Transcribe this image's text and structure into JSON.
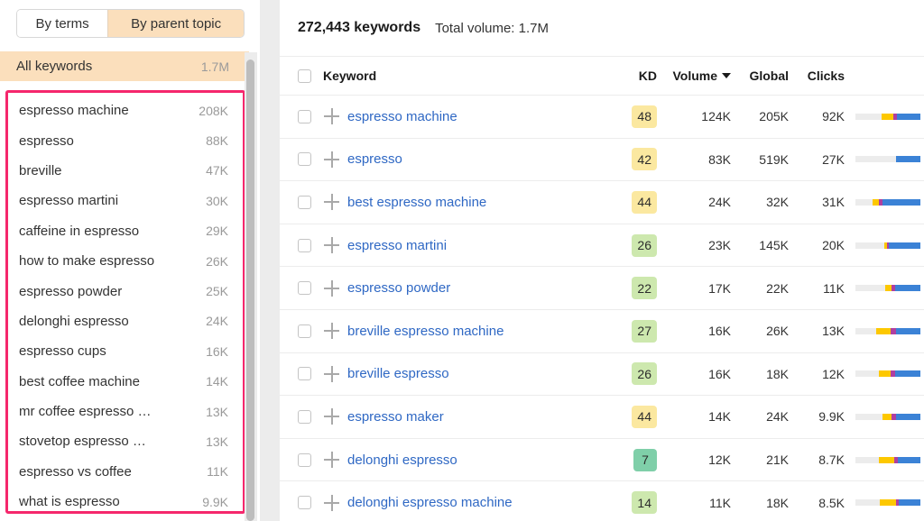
{
  "sidebar": {
    "tabs": [
      {
        "label": "By terms",
        "active": false
      },
      {
        "label": "By parent topic",
        "active": true
      }
    ],
    "all_keywords": {
      "label": "All keywords",
      "volume": "1.7M"
    },
    "highlight_color": "#f5276c",
    "items": [
      {
        "label": "espresso machine",
        "volume": "208K"
      },
      {
        "label": "espresso",
        "volume": "88K"
      },
      {
        "label": "breville",
        "volume": "47K"
      },
      {
        "label": "espresso martini",
        "volume": "30K"
      },
      {
        "label": "caffeine in espresso",
        "volume": "29K"
      },
      {
        "label": "how to make espresso",
        "volume": "26K"
      },
      {
        "label": "espresso powder",
        "volume": "25K"
      },
      {
        "label": "delonghi espresso",
        "volume": "24K"
      },
      {
        "label": "espresso cups",
        "volume": "16K"
      },
      {
        "label": "best coffee machine",
        "volume": "14K"
      },
      {
        "label": "mr coffee espresso …",
        "volume": "13K"
      },
      {
        "label": "stovetop espresso …",
        "volume": "13K"
      },
      {
        "label": "espresso vs coffee",
        "volume": "11K"
      },
      {
        "label": "what is espresso",
        "volume": "9.9K"
      }
    ]
  },
  "main": {
    "keyword_count": "272,443 keywords",
    "total_volume": "Total volume: 1.7M",
    "columns": {
      "keyword": "Keyword",
      "kd": "KD",
      "volume": "Volume",
      "global": "Global",
      "clicks": "Clicks"
    },
    "sorted_by": "Volume",
    "rows": [
      {
        "keyword": "espresso machine",
        "kd": "48",
        "kd_color": "#fbe8a0",
        "volume": "124K",
        "global": "205K",
        "clicks": "92K",
        "serp": [
          {
            "color": "#ececec",
            "pct": 40
          },
          {
            "color": "#fdc800",
            "pct": 18
          },
          {
            "color": "#b03fa0",
            "pct": 6
          },
          {
            "color": "#3b82d6",
            "pct": 36
          }
        ]
      },
      {
        "keyword": "espresso",
        "kd": "42",
        "kd_color": "#fbe8a0",
        "volume": "83K",
        "global": "519K",
        "clicks": "27K",
        "serp": [
          {
            "color": "#ececec",
            "pct": 63
          },
          {
            "color": "#fdc800",
            "pct": 0
          },
          {
            "color": "#b03fa0",
            "pct": 0
          },
          {
            "color": "#3b82d6",
            "pct": 37
          }
        ]
      },
      {
        "keyword": "best espresso machine",
        "kd": "44",
        "kd_color": "#fbe8a0",
        "volume": "24K",
        "global": "32K",
        "clicks": "31K",
        "serp": [
          {
            "color": "#ececec",
            "pct": 26
          },
          {
            "color": "#fdc800",
            "pct": 10
          },
          {
            "color": "#b03fa0",
            "pct": 6
          },
          {
            "color": "#3b82d6",
            "pct": 58
          }
        ]
      },
      {
        "keyword": "espresso martini",
        "kd": "26",
        "kd_color": "#cde8ae",
        "volume": "23K",
        "global": "145K",
        "clicks": "20K",
        "serp": [
          {
            "color": "#ececec",
            "pct": 44
          },
          {
            "color": "#fdc800",
            "pct": 4
          },
          {
            "color": "#b03fa0",
            "pct": 4
          },
          {
            "color": "#3b82d6",
            "pct": 48
          }
        ]
      },
      {
        "keyword": "espresso powder",
        "kd": "22",
        "kd_color": "#cde8ae",
        "volume": "17K",
        "global": "22K",
        "clicks": "11K",
        "serp": [
          {
            "color": "#ececec",
            "pct": 46
          },
          {
            "color": "#fdc800",
            "pct": 9
          },
          {
            "color": "#b03fa0",
            "pct": 6
          },
          {
            "color": "#3b82d6",
            "pct": 39
          }
        ]
      },
      {
        "keyword": "breville espresso machine",
        "kd": "27",
        "kd_color": "#cde8ae",
        "volume": "16K",
        "global": "26K",
        "clicks": "13K",
        "serp": [
          {
            "color": "#ececec",
            "pct": 32
          },
          {
            "color": "#fdc800",
            "pct": 22
          },
          {
            "color": "#b03fa0",
            "pct": 8
          },
          {
            "color": "#3b82d6",
            "pct": 38
          }
        ]
      },
      {
        "keyword": "breville espresso",
        "kd": "26",
        "kd_color": "#cde8ae",
        "volume": "16K",
        "global": "18K",
        "clicks": "12K",
        "serp": [
          {
            "color": "#ececec",
            "pct": 36
          },
          {
            "color": "#fdc800",
            "pct": 18
          },
          {
            "color": "#b03fa0",
            "pct": 7
          },
          {
            "color": "#3b82d6",
            "pct": 39
          }
        ]
      },
      {
        "keyword": "espresso maker",
        "kd": "44",
        "kd_color": "#fbe8a0",
        "volume": "14K",
        "global": "24K",
        "clicks": "9.9K",
        "serp": [
          {
            "color": "#ececec",
            "pct": 42
          },
          {
            "color": "#fdc800",
            "pct": 14
          },
          {
            "color": "#b03fa0",
            "pct": 7
          },
          {
            "color": "#3b82d6",
            "pct": 37
          }
        ]
      },
      {
        "keyword": "delonghi espresso",
        "kd": "7",
        "kd_color": "#7fcfa9",
        "volume": "12K",
        "global": "21K",
        "clicks": "8.7K",
        "serp": [
          {
            "color": "#ececec",
            "pct": 36
          },
          {
            "color": "#fdc800",
            "pct": 24
          },
          {
            "color": "#b03fa0",
            "pct": 6
          },
          {
            "color": "#3b82d6",
            "pct": 34
          }
        ]
      },
      {
        "keyword": "delonghi espresso machine",
        "kd": "14",
        "kd_color": "#cde8ae",
        "volume": "11K",
        "global": "18K",
        "clicks": "8.5K",
        "serp": [
          {
            "color": "#ececec",
            "pct": 38
          },
          {
            "color": "#fdc800",
            "pct": 24
          },
          {
            "color": "#b03fa0",
            "pct": 5
          },
          {
            "color": "#3b82d6",
            "pct": 33
          }
        ]
      }
    ]
  }
}
